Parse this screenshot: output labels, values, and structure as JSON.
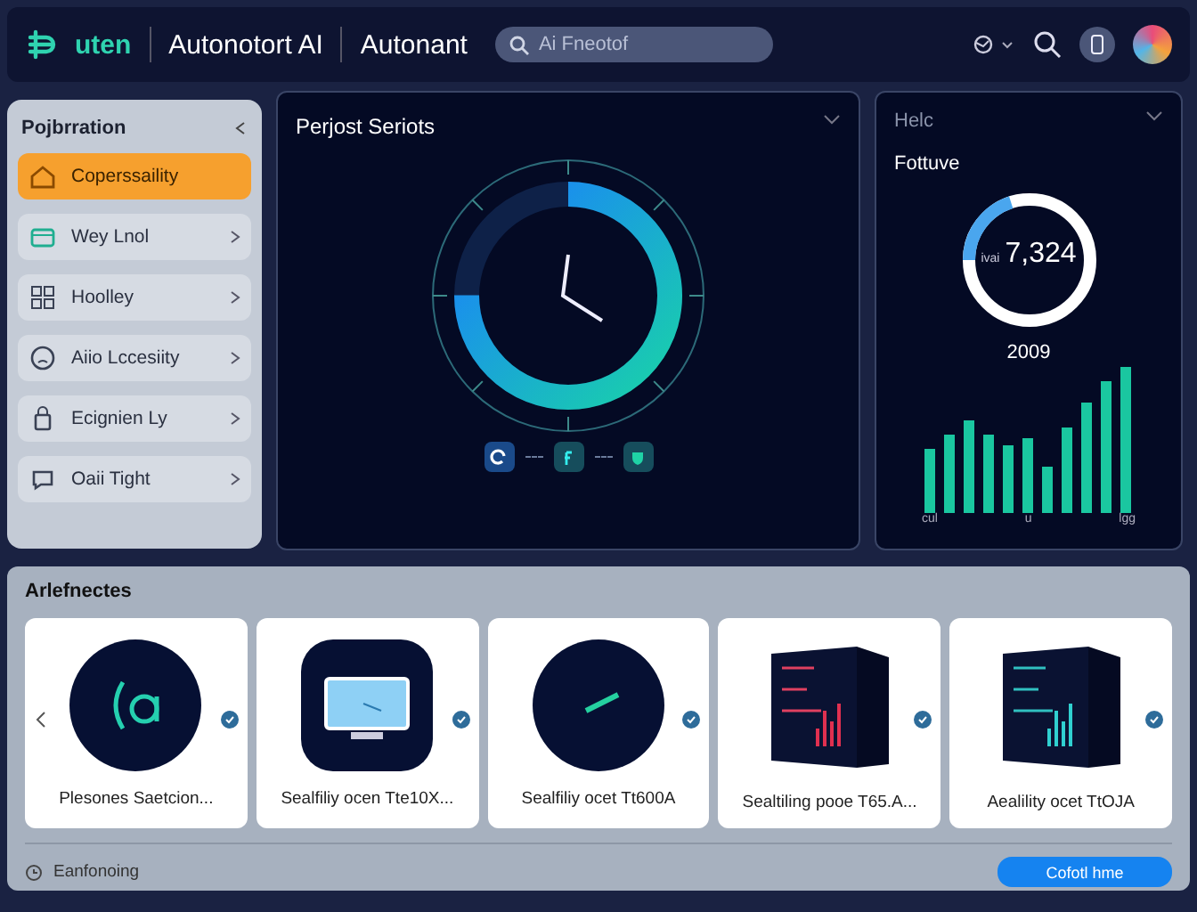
{
  "header": {
    "brand": "uten",
    "title": "Autonotort AI",
    "subtitle": "Autonant",
    "search": {
      "placeholder": "Ai Fneotof"
    }
  },
  "sidebar": {
    "title": "Pojbrration",
    "items": [
      {
        "label": "Coperssaility",
        "selected": true,
        "kind": "home"
      },
      {
        "label": "Wey Lnol",
        "selected": false,
        "kind": "folder"
      },
      {
        "label": "Hoolley",
        "selected": false,
        "kind": "grid"
      },
      {
        "label": "Aiio Lccesiity",
        "selected": false,
        "kind": "face"
      },
      {
        "label": "Ecignien Ly",
        "selected": false,
        "kind": "lock"
      },
      {
        "label": "Oaii Tight",
        "selected": false,
        "kind": "chat"
      }
    ]
  },
  "clock_panel": {
    "title": "Perjost Seriots",
    "level": 0.75
  },
  "stats_panel": {
    "title": "Helc",
    "subtitle": "Fottuve",
    "gauge": {
      "label": "ivai",
      "value": "7,324",
      "level": 0.2
    },
    "year": "2009",
    "bar_labels": [
      "cul",
      "u",
      "lgg"
    ]
  },
  "gallery": {
    "title": "Arlefnectes",
    "cards": [
      {
        "title": "Plesones Saetcion...",
        "kind": "ring"
      },
      {
        "title": "Sealfiliy ocen Tte10X...",
        "kind": "monitor"
      },
      {
        "title": "Sealfiliy ocet Tt600A",
        "kind": "dial"
      },
      {
        "title": "Sealtiling pooe T65.A...",
        "kind": "cube"
      },
      {
        "title": "Aealility ocet TtOJA",
        "kind": "cube2"
      }
    ],
    "footer_label": "Eanfonoing",
    "action": "Cofotl hme"
  }
}
